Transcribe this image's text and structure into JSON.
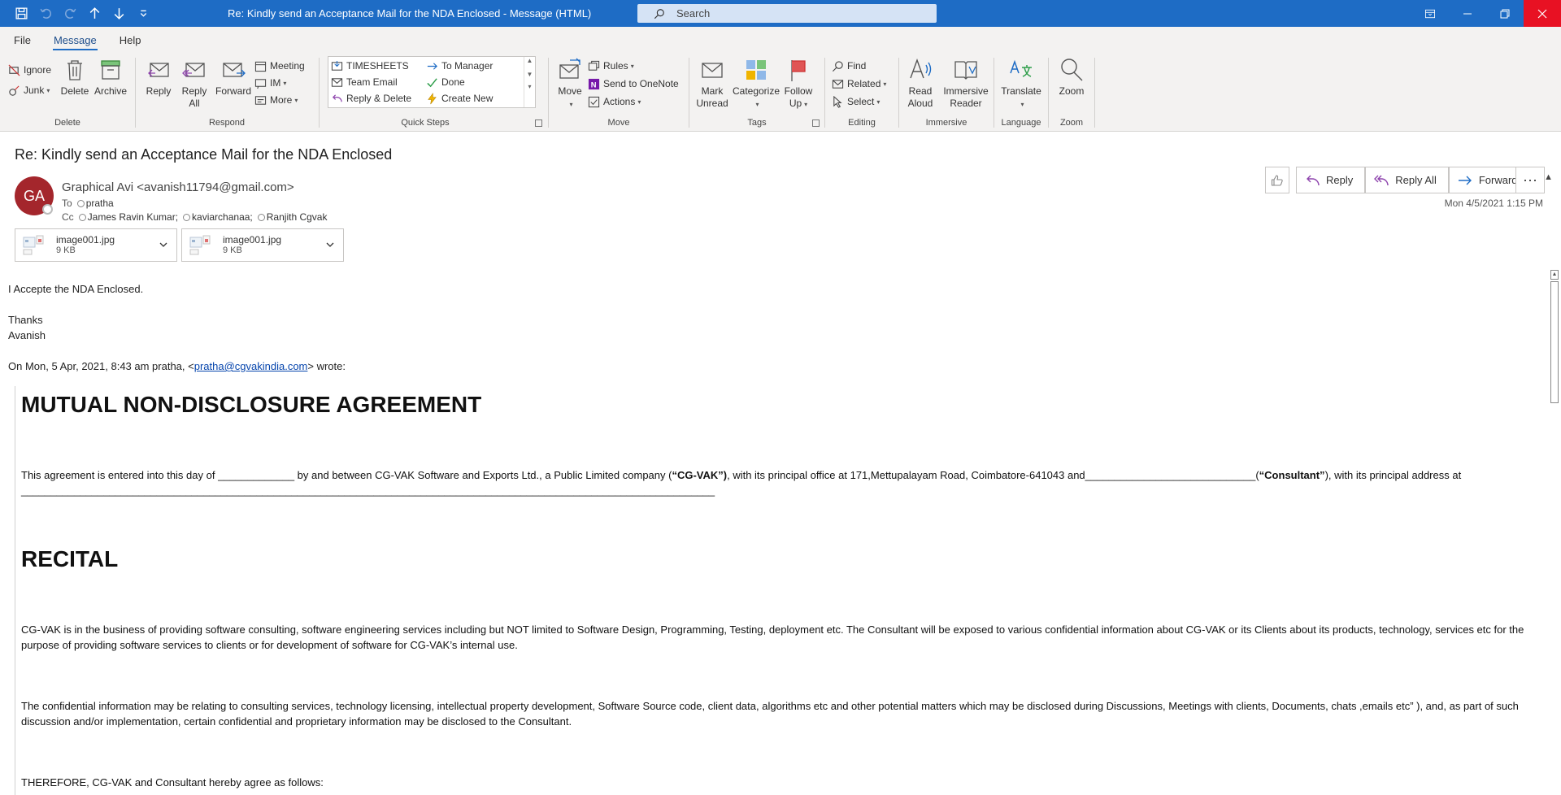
{
  "window": {
    "title": "Re: Kindly send an Acceptance Mail for the NDA Enclosed  -  Message (HTML)",
    "search_placeholder": "Search"
  },
  "menu": {
    "tabs": [
      "File",
      "Message",
      "Help"
    ],
    "active": "Message"
  },
  "ribbon": {
    "delete": {
      "label": "Delete",
      "ignore": "Ignore",
      "junk": "Junk",
      "delete_btn": "Delete",
      "archive": "Archive"
    },
    "respond": {
      "label": "Respond",
      "reply": "Reply",
      "reply_all_1": "Reply",
      "reply_all_2": "All",
      "forward": "Forward",
      "meeting": "Meeting",
      "im": "IM",
      "more": "More"
    },
    "quick_steps": {
      "label": "Quick Steps",
      "items": [
        "TIMESHEETS",
        "Team Email",
        "Reply & Delete",
        "To Manager",
        "Done",
        "Create New"
      ]
    },
    "move": {
      "label": "Move",
      "move_btn": "Move",
      "rules": "Rules",
      "onenote": "Send to OneNote",
      "actions": "Actions"
    },
    "tags": {
      "label": "Tags",
      "mark_unread_1": "Mark",
      "mark_unread_2": "Unread",
      "categorize": "Categorize",
      "follow_up_1": "Follow",
      "follow_up_2": "Up"
    },
    "editing": {
      "label": "Editing",
      "find": "Find",
      "related": "Related",
      "select": "Select"
    },
    "immersive": {
      "label": "Immersive",
      "read_aloud_1": "Read",
      "read_aloud_2": "Aloud",
      "immersive_reader_1": "Immersive",
      "immersive_reader_2": "Reader"
    },
    "language": {
      "label": "Language",
      "translate": "Translate"
    },
    "zoom": {
      "label": "Zoom",
      "zoom_btn": "Zoom"
    }
  },
  "message": {
    "subject": "Re: Kindly send an Acceptance Mail for the NDA Enclosed",
    "avatar_initials": "GA",
    "sender": "Graphical Avi <avanish11794@gmail.com>",
    "to_label": "To",
    "to": [
      "pratha"
    ],
    "cc_label": "Cc",
    "cc": [
      "James Ravin Kumar;",
      "kaviarchanaa;",
      "Ranjith Cgvak"
    ],
    "date": "Mon 4/5/2021 1:15 PM",
    "actions": {
      "reply": "Reply",
      "reply_all": "Reply All",
      "forward": "Forward",
      "more": "···"
    },
    "attachments": [
      {
        "name": "image001.jpg",
        "size": "9 KB"
      },
      {
        "name": "image001.jpg",
        "size": "9 KB"
      }
    ]
  },
  "body": {
    "line1": "I Accepte the NDA Enclosed.",
    "thanks": "Thanks",
    "name": "Avanish",
    "wrote_prefix": "On Mon, 5 Apr, 2021, 8:43 am pratha, <",
    "wrote_email": "pratha@cgvakindia.com",
    "wrote_suffix": "> wrote:"
  },
  "document": {
    "heading1": "MUTUAL NON-DISCLOSURE AGREEMENT",
    "para1_a": "This agreement is entered into this day of _____________ by and between CG-VAK Software and Exports Ltd., a Public Limited  company (",
    "para1_b": "“CG-VAK”)",
    "para1_c": ", with its principal office at 171,Mettupalayam Road, Coimbatore-641043 and_____________________________(",
    "para1_d": "“Consultant”",
    "para1_e": "), with its principal address at ______________________________________________________________________________________________________________________",
    "heading2": "RECITAL",
    "para2": "CG-VAK is in the business of providing software consulting, software engineering services including but NOT limited to Software Design, Programming, Testing, deployment etc. The Consultant will be exposed to various confidential information about CG-VAK or its Clients about its products, technology, services etc for the purpose of providing software services to clients or for development of software for CG-VAK’s internal use.",
    "para3": "The confidential information may be relating to consulting services, technology licensing, intellectual property development, Software Source code, client data, algorithms etc and other potential matters which may be disclosed during Discussions, Meetings with clients, Documents, chats ,emails etc” ), and, as part of such discussion and/or implementation, certain confidential and proprietary information may be disclosed to the Consultant.",
    "para4": "THEREFORE, CG-VAK and Consultant hereby agree as follows:"
  },
  "colors": {
    "titlebar": "#1e6cc5",
    "avatar": "#a4262c",
    "close": "#e81123",
    "link": "#0645ad"
  }
}
